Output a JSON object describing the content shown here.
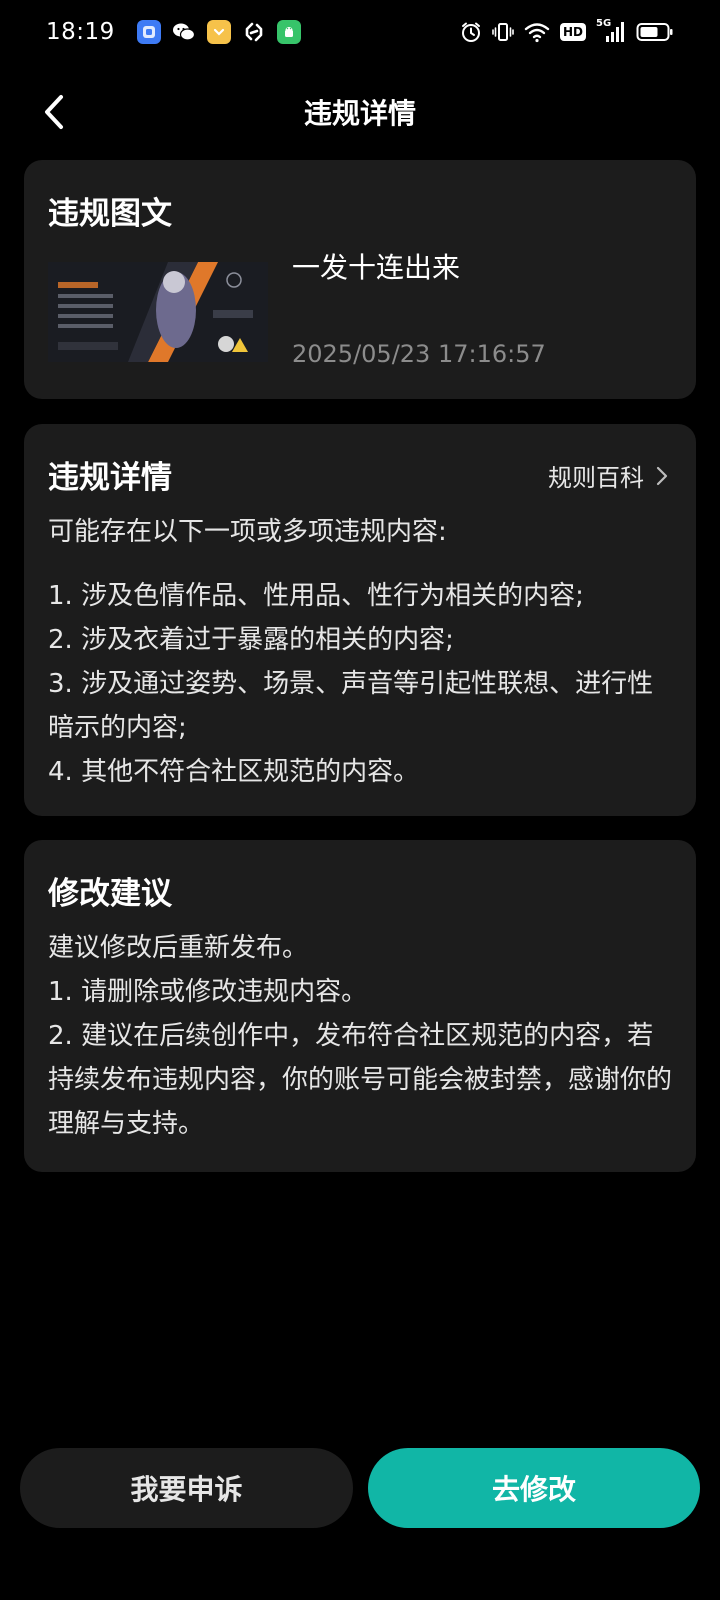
{
  "status_bar": {
    "time": "18:19",
    "apps": [
      {
        "icon": "blue-app-icon",
        "color": "#3e7bf5"
      },
      {
        "icon": "wechat-icon",
        "color": "#ffffff"
      },
      {
        "icon": "heart-app-icon",
        "color": "#f6c24a"
      },
      {
        "icon": "link-app-icon",
        "color": "#ffffff"
      },
      {
        "icon": "android-app-icon",
        "color": "#37c46a"
      }
    ],
    "hd_label": "HD",
    "network_label": "5G"
  },
  "header": {
    "title": "违规详情"
  },
  "violation_media": {
    "title": "违规图文",
    "post_title": "一发十连出来",
    "post_time": "2025/05/23 17:16:57"
  },
  "violation_details": {
    "title": "违规详情",
    "rules_link": "规则百科",
    "intro": "可能存在以下一项或多项违规内容:",
    "items": [
      "1. 涉及色情作品、性用品、性行为相关的内容;",
      "2. 涉及衣着过于暴露的相关的内容;",
      "3. 涉及通过姿势、场景、声音等引起性联想、进行性暗示的内容;",
      "4. 其他不符合社区规范的内容。"
    ]
  },
  "suggestions": {
    "title": "修改建议",
    "lines": [
      "建议修改后重新发布。",
      "1. 请删除或修改违规内容。",
      "2. 建议在后续创作中，发布符合社区规范的内容，若持续发布违规内容，你的账号可能会被封禁，感谢你的理解与支持。"
    ]
  },
  "actions": {
    "appeal": "我要申诉",
    "modify": "去修改"
  },
  "colors": {
    "background": "#000000",
    "card": "#1c1c1c",
    "accent": "#11b6a6"
  }
}
